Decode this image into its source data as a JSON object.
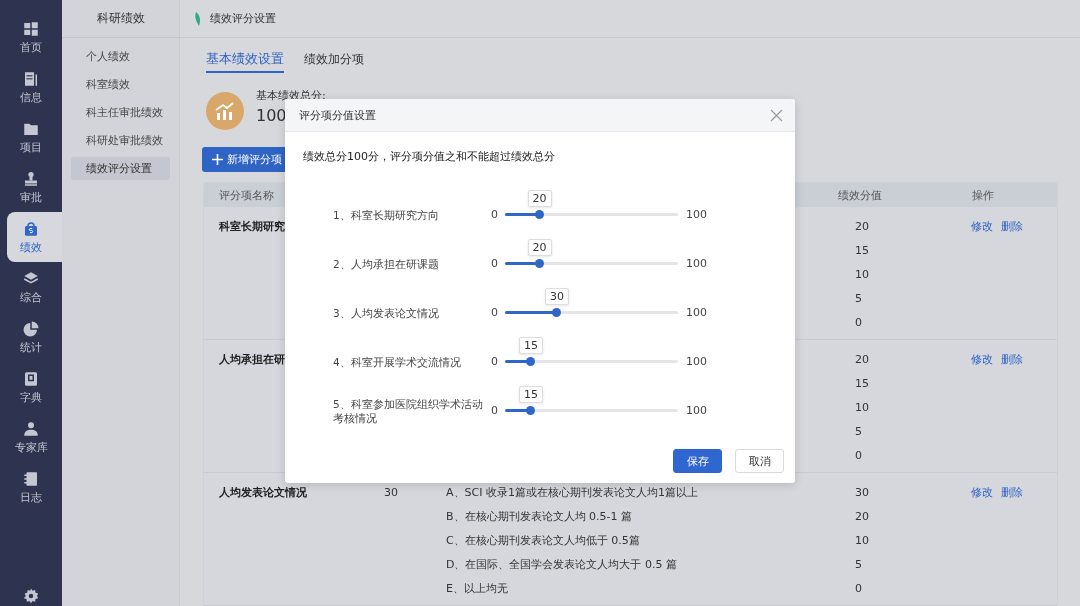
{
  "nav": [
    {
      "label": "首页",
      "selected": false
    },
    {
      "label": "信息",
      "selected": false
    },
    {
      "label": "项目",
      "selected": false
    },
    {
      "label": "审批",
      "selected": false
    },
    {
      "label": "绩效",
      "selected": true
    },
    {
      "label": "综合",
      "selected": false
    },
    {
      "label": "统计",
      "selected": false
    },
    {
      "label": "字典",
      "selected": false
    },
    {
      "label": "专家库",
      "selected": false
    },
    {
      "label": "日志",
      "selected": false
    }
  ],
  "submenu": {
    "title": "科研绩效",
    "items": [
      {
        "label": "个人绩效",
        "selected": false
      },
      {
        "label": "科室绩效",
        "selected": false
      },
      {
        "label": "科主任审批绩效",
        "selected": false
      },
      {
        "label": "科研处审批绩效",
        "selected": false
      },
      {
        "label": "绩效评分设置",
        "selected": true
      }
    ]
  },
  "breadcrumb": "绩效评分设置",
  "tabs": [
    {
      "label": "基本绩效设置",
      "selected": true
    },
    {
      "label": "绩效加分项",
      "selected": false
    }
  ],
  "total": {
    "label": "基本绩效总分:",
    "value": "100"
  },
  "add_button": "新增评分项",
  "table": {
    "columns": [
      "评分项名称",
      "绩效分值",
      "操作"
    ],
    "rows": [
      {
        "name": "科室长期研究",
        "values": [
          "20",
          "15",
          "10",
          "5",
          "0"
        ],
        "actions": [
          "修改",
          "删除"
        ]
      },
      {
        "name": "人均承担在研",
        "values": [
          "20",
          "15",
          "10",
          "5",
          "0"
        ],
        "actions": [
          "修改",
          "删除"
        ]
      },
      {
        "name": "人均发表论文情况",
        "score": "30",
        "criteria": [
          "A、SCI 收录1篇或在核心期刊发表论文人均1篇以上",
          "B、在核心期刊发表论文人均 0.5-1 篇",
          "C、在核心期刊发表论文人均低于 0.5篇",
          "D、在国际、全国学会发表论文人均大于 0.5 篇",
          "E、以上均无"
        ],
        "values": [
          "30",
          "20",
          "10",
          "5",
          "0"
        ],
        "actions": [
          "修改",
          "删除"
        ]
      }
    ]
  },
  "dialog": {
    "title": "评分项分值设置",
    "notice": "绩效总分100分，评分项分值之和不能超过绩效总分",
    "sliders": [
      {
        "label": "1、科室长期研究方向",
        "min": "0",
        "max": "100",
        "value": "20",
        "level": 0.2
      },
      {
        "label": "2、人均承担在研课题",
        "min": "0",
        "max": "100",
        "value": "20",
        "level": 0.2
      },
      {
        "label": "3、人均发表论文情况",
        "min": "0",
        "max": "100",
        "value": "30",
        "level": 0.3
      },
      {
        "label": "4、科室开展学术交流情况",
        "min": "0",
        "max": "100",
        "value": "15",
        "level": 0.15
      },
      {
        "label": "5、科室参加医院组织学术活动考核情况",
        "min": "0",
        "max": "100",
        "value": "15",
        "level": 0.15
      }
    ],
    "buttons": [
      {
        "label": "保存",
        "kind": "primary"
      },
      {
        "label": "取消",
        "kind": "default"
      }
    ]
  }
}
